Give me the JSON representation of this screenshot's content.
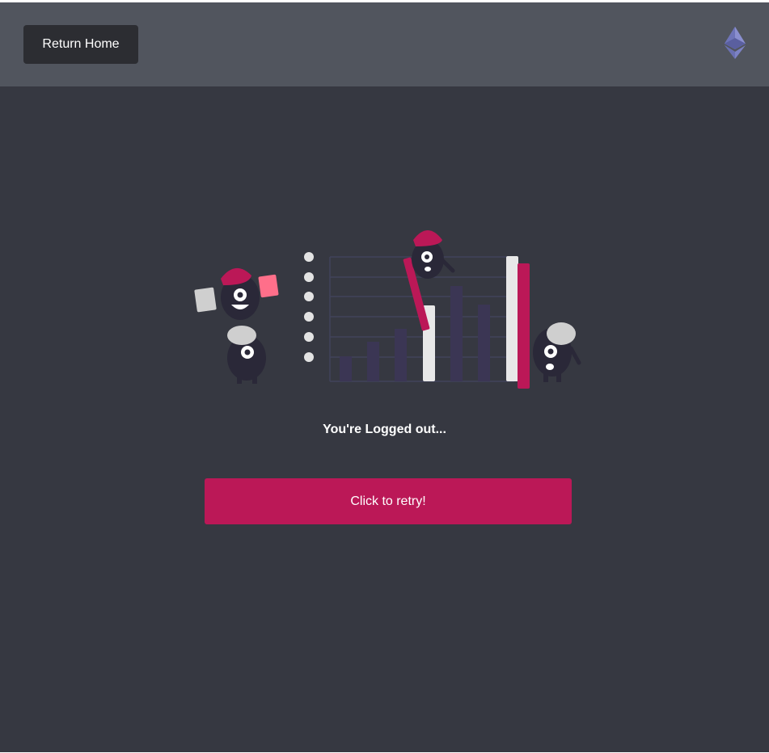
{
  "header": {
    "return_label": "Return Home",
    "logo_icon": "ethereum-icon"
  },
  "main": {
    "status_text": "You're Logged out...",
    "retry_label": "Click to retry!",
    "illustration_icon": "monsters-bar-chart-illustration"
  },
  "colors": {
    "background": "#363841",
    "header": "#51555e",
    "accent": "#bb1857",
    "button_dark": "#2c2d32"
  }
}
